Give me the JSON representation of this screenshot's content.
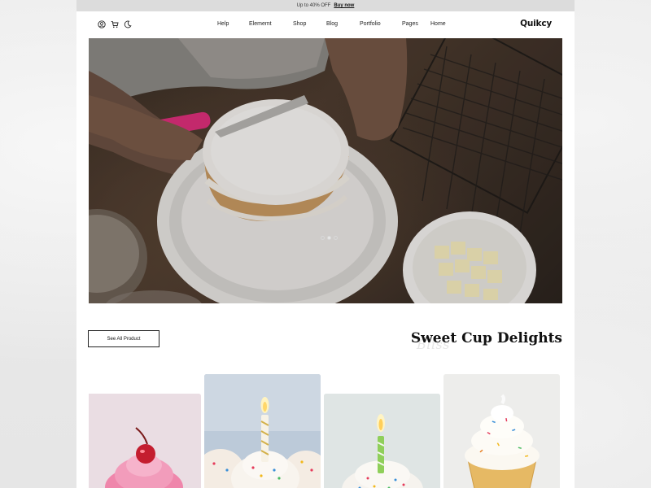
{
  "promo": {
    "text": "Up to 40% OFF",
    "link": "Buy now"
  },
  "header": {
    "icons": [
      "user-icon",
      "cart-icon",
      "moon-icon"
    ],
    "nav": [
      "Help",
      "Elememt",
      "Shop",
      "Blog",
      "Portfolio",
      "Pages",
      "Home"
    ],
    "logo": "Quikcy"
  },
  "hero": {
    "slides": 3,
    "active_slide": 2
  },
  "products_section": {
    "see_all_label": "See All Product",
    "title_part1": "Sweet ",
    "title_bold": "Cup",
    "title_part2": " Delights",
    "watermark": "Bliss"
  },
  "colors": {
    "promo_bg": "#dcdcdc",
    "page_bg": "#ffffff",
    "frosting_pink": "#f2a6c0",
    "cherry_red": "#c0182a"
  }
}
